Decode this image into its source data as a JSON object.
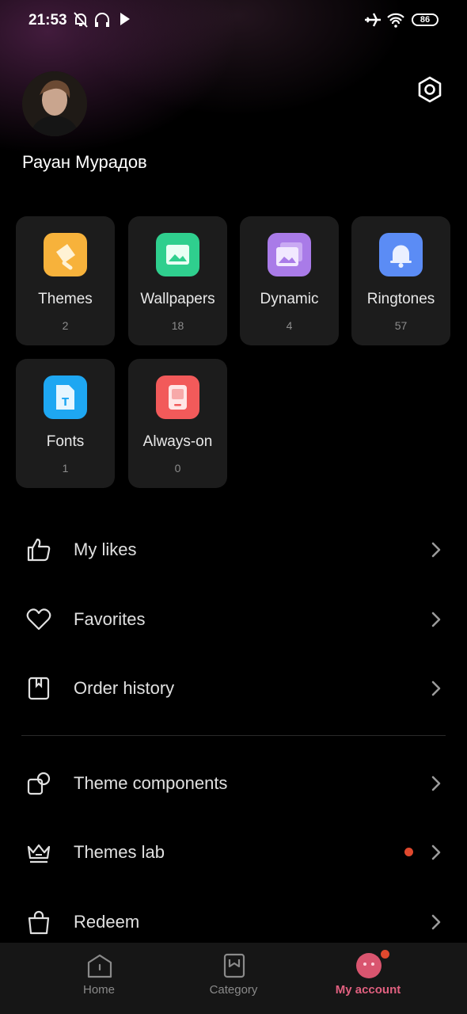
{
  "status_bar": {
    "time": "21:53",
    "battery": "86",
    "icons": [
      "mute-bell-icon",
      "headphones-icon",
      "play-icon",
      "airplane-icon",
      "wifi-icon",
      "battery-icon"
    ]
  },
  "profile": {
    "name": "Рауан Мурадов",
    "settings_icon": "hexagon-settings-icon"
  },
  "categories": [
    {
      "label": "Themes",
      "count": "2",
      "icon": "brush-icon",
      "color": "#f7b23b"
    },
    {
      "label": "Wallpapers",
      "count": "18",
      "icon": "image-icon",
      "color": "#2fcf8e"
    },
    {
      "label": "Dynamic",
      "count": "4",
      "icon": "layered-image-icon",
      "color": "#a97be8"
    },
    {
      "label": "Ringtones",
      "count": "57",
      "icon": "bell-icon",
      "color": "#5b8cf5"
    },
    {
      "label": "Fonts",
      "count": "1",
      "icon": "font-file-icon",
      "color": "#1ea7f2"
    },
    {
      "label": "Always-on",
      "count": "0",
      "icon": "phone-screen-icon",
      "color": "#f25a5a"
    }
  ],
  "menu": [
    {
      "label": "My likes",
      "icon": "thumbs-up-icon"
    },
    {
      "label": "Favorites",
      "icon": "heart-icon"
    },
    {
      "label": "Order history",
      "icon": "bookmark-note-icon"
    },
    {
      "label": "Theme components",
      "icon": "components-icon"
    },
    {
      "label": "Themes lab",
      "icon": "crown-icon",
      "has_dot": true
    },
    {
      "label": "Redeem",
      "icon": "shopping-bag-icon"
    }
  ],
  "bottom_nav": [
    {
      "label": "Home",
      "icon": "home-icon",
      "active": false
    },
    {
      "label": "Category",
      "icon": "category-icon",
      "active": false
    },
    {
      "label": "My account",
      "icon": "account-face-icon",
      "active": true
    }
  ],
  "colors": {
    "accent": "#e0607f",
    "notification_dot": "#e0492e",
    "tile_bg": "#1c1c1c"
  }
}
